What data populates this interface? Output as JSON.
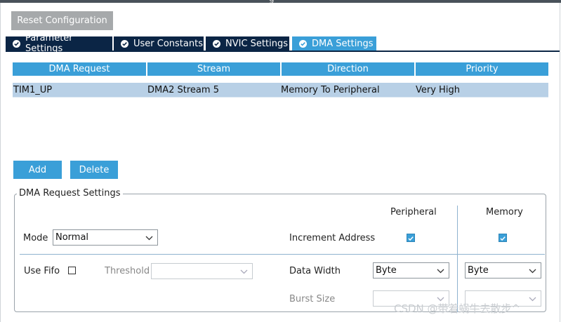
{
  "toolbar": {
    "reset_label": "Reset Configuration"
  },
  "tabs": [
    {
      "label": "Parameter Settings",
      "active": false
    },
    {
      "label": "User Constants",
      "active": false
    },
    {
      "label": "NVIC Settings",
      "active": false
    },
    {
      "label": "DMA Settings",
      "active": true
    }
  ],
  "dma_table": {
    "headers": [
      "DMA Request",
      "Stream",
      "Direction",
      "Priority"
    ],
    "rows": [
      {
        "request": "TIM1_UP",
        "stream": "DMA2 Stream 5",
        "direction": "Memory To Peripheral",
        "priority": "Very High"
      }
    ]
  },
  "actions": {
    "add_label": "Add",
    "delete_label": "Delete"
  },
  "settings": {
    "title": "DMA Request Settings",
    "peripheral_header": "Peripheral",
    "memory_header": "Memory",
    "mode_label": "Mode",
    "mode_value": "Normal",
    "increment_label": "Increment Address",
    "increment_peripheral": true,
    "increment_memory": true,
    "use_fifo_label": "Use Fifo",
    "use_fifo": false,
    "threshold_label": "Threshold",
    "threshold_value": "",
    "data_width_label": "Data Width",
    "data_width_peripheral": "Byte",
    "data_width_memory": "Byte",
    "burst_size_label": "Burst Size",
    "burst_peripheral": "",
    "burst_memory": ""
  },
  "watermark": "CSDN @带着蜗牛去散步^",
  "colors": {
    "accent": "#3a9fd8",
    "tab_dark": "#0b2545",
    "row_selected": "#b8d0e6",
    "reset_button": "#a6a9ab"
  }
}
